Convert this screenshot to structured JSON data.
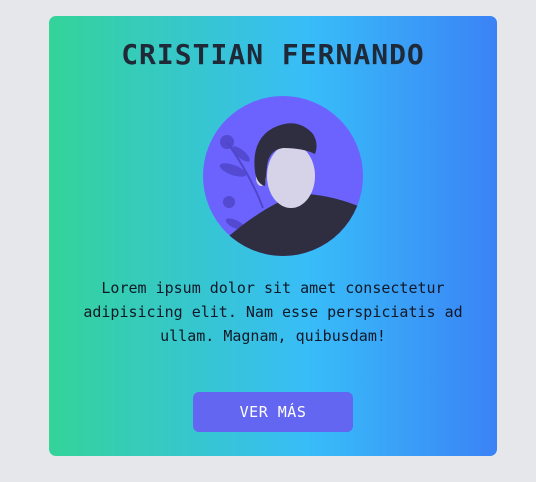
{
  "profile": {
    "name": "CRISTIAN FERNANDO",
    "bio": "Lorem ipsum dolor sit amet consectetur adipisicing elit. Nam esse perspiciatis ad ullam. Magnam, quibusdam!",
    "cta_label": "VER MÁS"
  },
  "icons": {
    "avatar": "person-avatar-illustration"
  },
  "colors": {
    "page_background": "#e5e7eb",
    "card_gradient_start": "#34d399",
    "card_gradient_end": "#3b82f6",
    "avatar_background": "#6c63ff",
    "button": "#6366f1",
    "title_text": "#1f2937"
  }
}
